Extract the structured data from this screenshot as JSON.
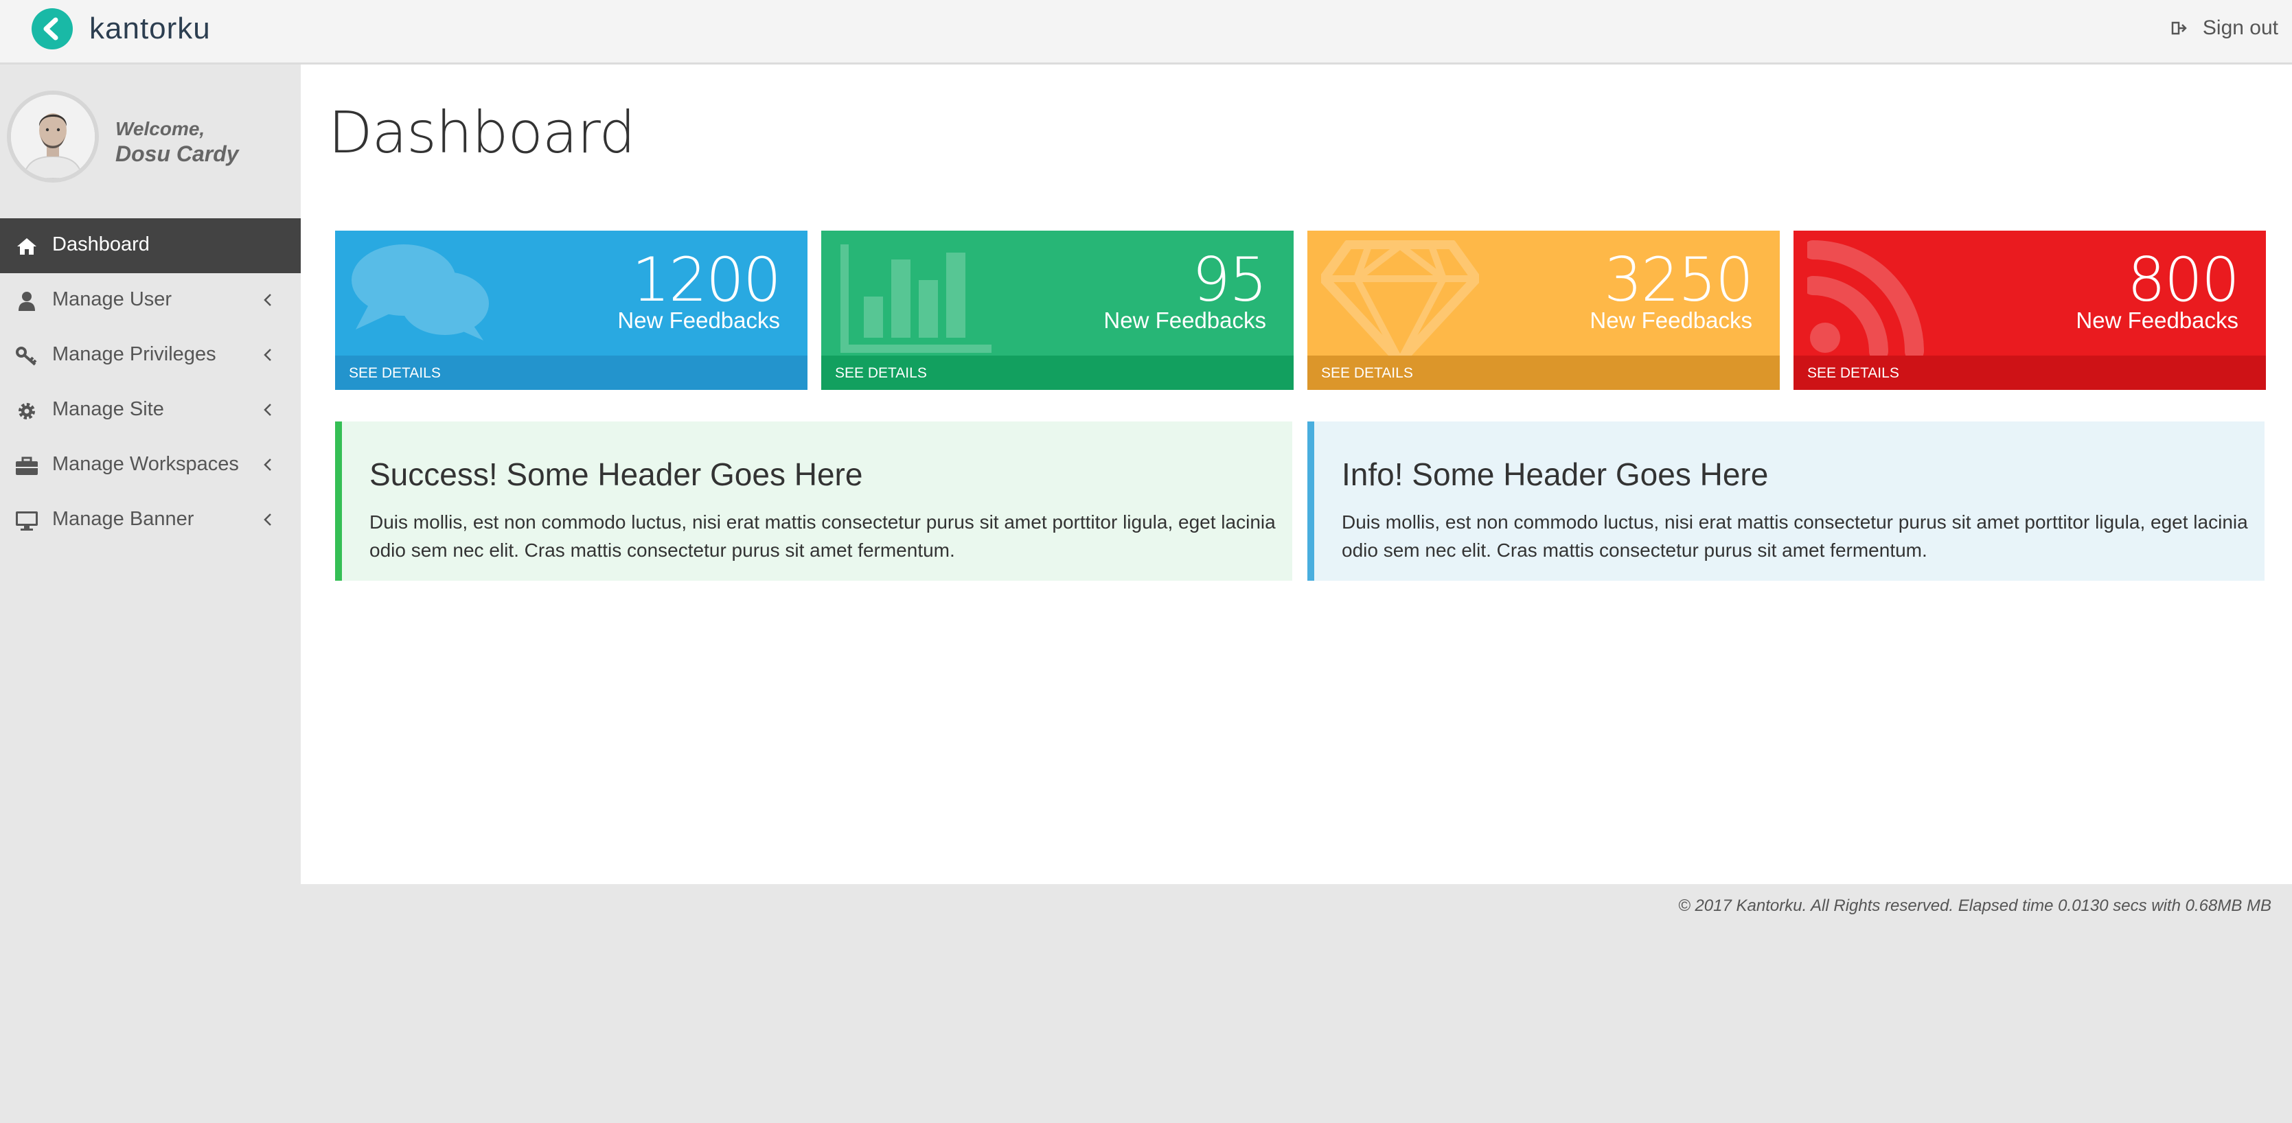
{
  "app": {
    "brand": "kantorku"
  },
  "header": {
    "signout_label": "Sign out"
  },
  "user": {
    "welcome": "Welcome,",
    "name": "Dosu Cardy"
  },
  "sidebar": {
    "items": [
      {
        "label": "Dashboard",
        "icon": "home-icon",
        "active": true
      },
      {
        "label": "Manage User",
        "icon": "user-icon"
      },
      {
        "label": "Manage Privileges",
        "icon": "key-icon"
      },
      {
        "label": "Manage Site",
        "icon": "gear-icon"
      },
      {
        "label": "Manage Workspaces",
        "icon": "briefcase-icon"
      },
      {
        "label": "Manage Banner",
        "icon": "monitor-icon"
      }
    ]
  },
  "page": {
    "title": "Dashboard"
  },
  "cards": [
    {
      "value": "1200",
      "label": "New Feedbacks",
      "link": "SEE DETAILS",
      "icon": "comments-icon",
      "color": "#29a9e1",
      "foot_color": "#2394cd"
    },
    {
      "value": "95",
      "label": "New Feedbacks",
      "link": "SEE DETAILS",
      "icon": "bar-chart-icon",
      "color": "#27b676",
      "foot_color": "#12a05f"
    },
    {
      "value": "3250",
      "label": "New Feedbacks",
      "link": "SEE DETAILS",
      "icon": "diamond-icon",
      "color": "#feb848",
      "foot_color": "#dc962a"
    },
    {
      "value": "800",
      "label": "New Feedbacks",
      "link": "SEE DETAILS",
      "icon": "rss-icon",
      "color": "#ea1b1f",
      "foot_color": "#ce1216"
    }
  ],
  "alerts": [
    {
      "title": "Success! Some Header Goes Here",
      "text": "Duis mollis, est non commodo luctus, nisi erat mattis consectetur purus sit amet porttitor ligula, eget lacinia odio sem nec elit. Cras mattis consectetur purus sit amet fermentum.",
      "bg": "#eaf8ee",
      "border": "#35bf55"
    },
    {
      "title": "Info! Some Header Goes Here",
      "text": "Duis mollis, est non commodo luctus, nisi erat mattis consectetur purus sit amet porttitor ligula, eget lacinia odio sem nec elit. Cras mattis consectetur purus sit amet fermentum.",
      "bg": "#e8f4f9",
      "border": "#49aede"
    }
  ],
  "footer": {
    "text": "© 2017 Kantorku. All Rights reserved. Elapsed time 0.0130 secs with 0.68MB MB"
  }
}
